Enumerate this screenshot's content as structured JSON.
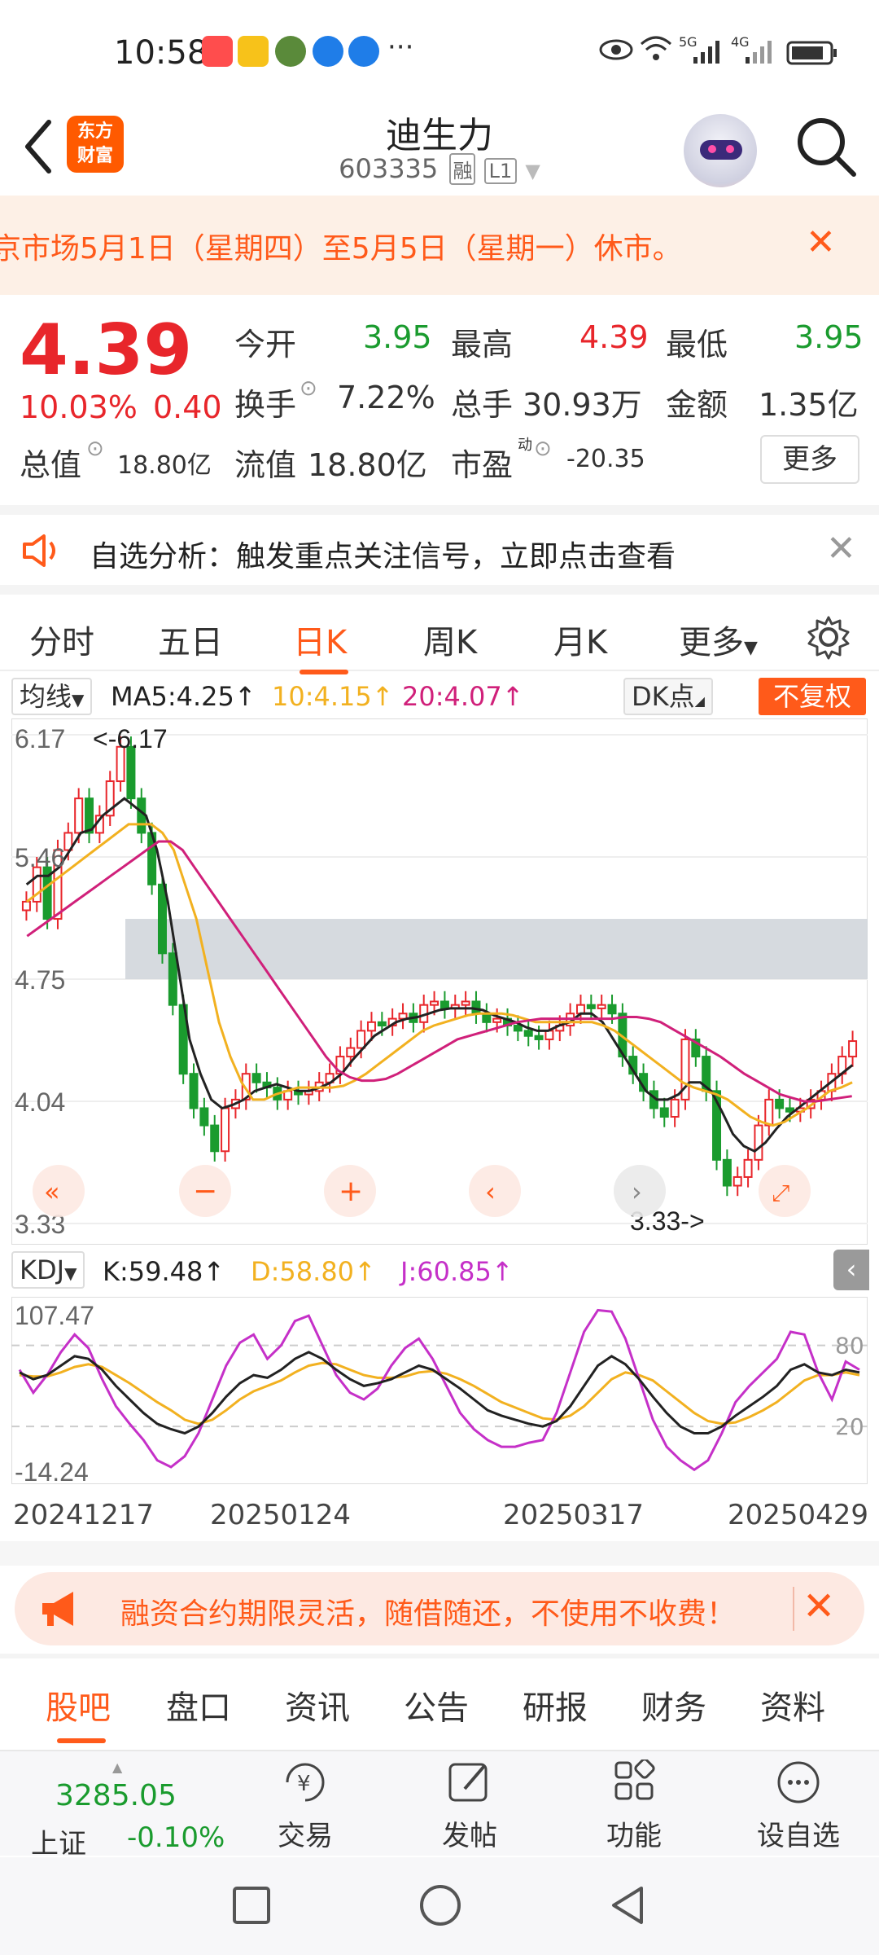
{
  "status": {
    "time": "10:58",
    "more": "···",
    "network1": "5G",
    "network2": "4G"
  },
  "header": {
    "logo_line1": "东方",
    "logo_line2": "财富",
    "stock_name": "迪生力",
    "stock_code": "603335",
    "tag_rong": "融",
    "tag_level": "L1"
  },
  "notice": {
    "text": "京市场5月1日（星期四）至5月5日（星期一）休市。"
  },
  "quote": {
    "price": "4.39",
    "change_pct": "10.03%",
    "change": "0.40",
    "open_label": "今开",
    "open": "3.95",
    "high_label": "最高",
    "high": "4.39",
    "low_label": "最低",
    "low": "3.95",
    "turnover_label": "换手",
    "turnover": "7.22%",
    "volume_label": "总手",
    "volume": "30.93万",
    "amount_label": "金额",
    "amount": "1.35亿",
    "mktcap_label": "总值",
    "mktcap": "18.80亿",
    "float_label": "流值",
    "float": "18.80亿",
    "pe_label": "市盈",
    "pe_sup": "动",
    "pe": "-20.35",
    "more": "更多"
  },
  "analysis": {
    "text": "自选分析：触发重点关注信号，立即点击查看"
  },
  "tabs": [
    "分时",
    "五日",
    "日K",
    "周K",
    "月K",
    "更多"
  ],
  "ma": {
    "selector": "均线",
    "ma5": "MA5:4.25↑",
    "ma10": "10:4.15↑",
    "ma20": "20:4.07↑",
    "dk": "DK点",
    "fuquan": "不复权"
  },
  "kdj": {
    "selector": "KDJ",
    "k": "K:59.48↑",
    "d": "D:58.80↑",
    "j": "J:60.85↑"
  },
  "chart_data": [
    {
      "type": "candlestick",
      "price_labels": [
        "6.17",
        "5.46",
        "4.75",
        "4.04",
        "3.33"
      ],
      "ylim": [
        3.33,
        6.17
      ],
      "max_marker": "<-6.17",
      "min_marker": "3.33->",
      "highlight_zone": [
        4.75,
        5.1
      ],
      "closes": [
        5.2,
        5.4,
        5.1,
        5.5,
        5.6,
        5.8,
        5.6,
        5.7,
        5.9,
        6.1,
        5.8,
        5.6,
        5.3,
        4.9,
        4.6,
        4.2,
        4.0,
        3.9,
        3.75,
        4.0,
        4.05,
        4.2,
        4.15,
        4.12,
        4.05,
        4.1,
        4.08,
        4.1,
        4.15,
        4.2,
        4.3,
        4.35,
        4.45,
        4.5,
        4.48,
        4.52,
        4.55,
        4.5,
        4.6,
        4.62,
        4.58,
        4.6,
        4.62,
        4.55,
        4.5,
        4.52,
        4.48,
        4.45,
        4.42,
        4.4,
        4.45,
        4.48,
        4.55,
        4.6,
        4.58,
        4.6,
        4.55,
        4.3,
        4.2,
        4.1,
        4.0,
        3.95,
        4.05,
        4.4,
        4.3,
        4.1,
        3.7,
        3.55,
        3.6,
        3.7,
        3.9,
        4.05,
        4.0,
        3.98,
        4.0,
        4.05,
        4.1,
        4.2,
        4.3,
        4.39
      ],
      "ma5": [
        5.3,
        5.35,
        5.35,
        5.4,
        5.5,
        5.6,
        5.62,
        5.7,
        5.75,
        5.8,
        5.75,
        5.7,
        5.5,
        5.2,
        4.8,
        4.4,
        4.2,
        4.05,
        4.0,
        4.02,
        4.05,
        4.1,
        4.12,
        4.14,
        4.12,
        4.1,
        4.1,
        4.12,
        4.15,
        4.2,
        4.28,
        4.35,
        4.42,
        4.46,
        4.5,
        4.52,
        4.53,
        4.55,
        4.57,
        4.58,
        4.58,
        4.58,
        4.57,
        4.54,
        4.52,
        4.5,
        4.47,
        4.45,
        4.45,
        4.48,
        4.5,
        4.55,
        4.55,
        4.5,
        4.4,
        4.3,
        4.2,
        4.1,
        4.05,
        4.05,
        4.08,
        4.15,
        4.15,
        4.1,
        3.98,
        3.85,
        3.78,
        3.75,
        3.8,
        3.88,
        3.95,
        4.0,
        4.05,
        4.1,
        4.15,
        4.2,
        4.25
      ],
      "ma10": [
        5.2,
        5.25,
        5.3,
        5.35,
        5.4,
        5.45,
        5.5,
        5.55,
        5.6,
        5.65,
        5.65,
        5.65,
        5.6,
        5.5,
        5.3,
        5.1,
        4.8,
        4.5,
        4.3,
        4.15,
        4.05,
        4.05,
        4.08,
        4.1,
        4.12,
        4.12,
        4.12,
        4.12,
        4.13,
        4.16,
        4.2,
        4.25,
        4.3,
        4.35,
        4.4,
        4.45,
        4.48,
        4.5,
        4.52,
        4.54,
        4.55,
        4.55,
        4.55,
        4.54,
        4.52,
        4.5,
        4.5,
        4.5,
        4.5,
        4.5,
        4.5,
        4.48,
        4.45,
        4.4,
        4.35,
        4.3,
        4.25,
        4.2,
        4.15,
        4.12,
        4.1,
        4.08,
        4.05,
        4.0,
        3.95,
        3.92,
        3.9,
        3.92,
        3.96,
        4.0,
        4.05,
        4.1,
        4.12,
        4.15
      ],
      "ma20": [
        5.0,
        5.05,
        5.1,
        5.15,
        5.2,
        5.25,
        5.3,
        5.35,
        5.4,
        5.45,
        5.5,
        5.55,
        5.55,
        5.5,
        5.4,
        5.3,
        5.2,
        5.1,
        5.0,
        4.9,
        4.8,
        4.7,
        4.6,
        4.5,
        4.4,
        4.3,
        4.22,
        4.18,
        4.16,
        4.16,
        4.17,
        4.2,
        4.24,
        4.28,
        4.32,
        4.36,
        4.4,
        4.42,
        4.44,
        4.46,
        4.48,
        4.5,
        4.51,
        4.52,
        4.52,
        4.52,
        4.52,
        4.52,
        4.52,
        4.52,
        4.53,
        4.53,
        4.52,
        4.5,
        4.46,
        4.42,
        4.38,
        4.34,
        4.3,
        4.25,
        4.2,
        4.16,
        4.12,
        4.08,
        4.06,
        4.04,
        4.04,
        4.05,
        4.06,
        4.07
      ]
    },
    {
      "type": "line",
      "name": "KDJ",
      "y_labels": [
        "107.47",
        "-14.24"
      ],
      "ylim": [
        -14.24,
        107.47
      ],
      "ref_lines": [
        80,
        20
      ],
      "ref_labels": [
        "80",
        "20"
      ],
      "x_labels": [
        "20241217",
        "20250124",
        "20250317",
        "20250429"
      ],
      "k": [
        60,
        55,
        58,
        65,
        72,
        70,
        62,
        50,
        40,
        30,
        22,
        18,
        15,
        20,
        30,
        42,
        52,
        58,
        56,
        62,
        70,
        75,
        70,
        62,
        55,
        50,
        52,
        55,
        60,
        65,
        62,
        55,
        48,
        40,
        32,
        28,
        25,
        22,
        20,
        24,
        35,
        50,
        65,
        72,
        66,
        55,
        42,
        30,
        20,
        15,
        15,
        20,
        28,
        35,
        42,
        50,
        62,
        66,
        60,
        58,
        62,
        60
      ],
      "d": [
        58,
        57,
        57,
        60,
        64,
        66,
        64,
        58,
        52,
        45,
        38,
        32,
        25,
        22,
        25,
        32,
        40,
        46,
        50,
        54,
        60,
        65,
        67,
        66,
        62,
        58,
        56,
        56,
        57,
        60,
        61,
        59,
        55,
        50,
        44,
        38,
        34,
        30,
        26,
        25,
        28,
        35,
        45,
        55,
        60,
        58,
        54,
        46,
        38,
        30,
        24,
        22,
        23,
        27,
        32,
        38,
        46,
        54,
        58,
        58,
        60,
        58
      ],
      "j": [
        62,
        45,
        58,
        75,
        88,
        78,
        55,
        35,
        22,
        10,
        -5,
        -10,
        -2,
        15,
        40,
        65,
        82,
        88,
        70,
        80,
        98,
        102,
        80,
        58,
        45,
        40,
        48,
        65,
        78,
        85,
        70,
        50,
        30,
        18,
        10,
        5,
        5,
        8,
        10,
        30,
        60,
        90,
        106,
        105,
        85,
        55,
        25,
        5,
        -5,
        -12,
        -5,
        15,
        38,
        50,
        60,
        70,
        90,
        88,
        60,
        40,
        68,
        62
      ]
    }
  ],
  "promo": {
    "text": "融资合约期限灵活，随借随还，不使用不收费！"
  },
  "sub_tabs": [
    "股吧",
    "盘口",
    "资讯",
    "公告",
    "研报",
    "财务",
    "资料"
  ],
  "bottom": {
    "index_value": "3285.05",
    "index_name": "上证",
    "index_change": "-0.10%",
    "trade": "交易",
    "post": "发帖",
    "functions": "功能",
    "set_watch": "设自选"
  },
  "colors": {
    "accent": "#ff5a1a",
    "up": "#e8262b",
    "down": "#1a9b2e",
    "ma5": "#222222",
    "ma10": "#f2b120",
    "ma20": "#d0207a",
    "kdj_j": "#c530c8"
  }
}
